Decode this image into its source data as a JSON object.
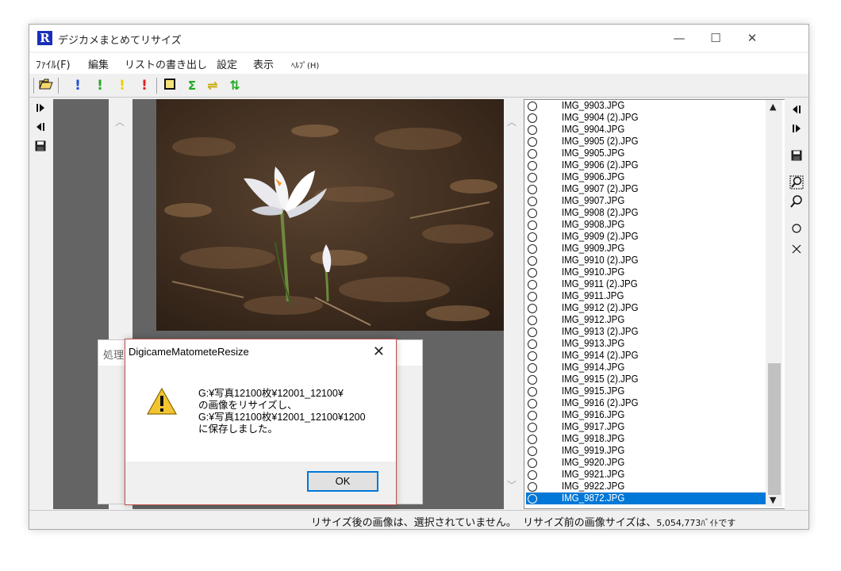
{
  "window": {
    "title": "デジカメまとめてリサイズ",
    "app_icon": "R",
    "minimize": "—",
    "maximize": "☐",
    "close": "✕"
  },
  "menu": [
    {
      "label": "ﾌｧｲﾙ(F)",
      "small": false
    },
    {
      "label": "編集",
      "small": false
    },
    {
      "label": "リストの書き出し",
      "small": false
    },
    {
      "label": "設定",
      "small": false
    },
    {
      "label": "表示",
      "small": false
    },
    {
      "label": "ﾍﾙﾌﾟ(H)",
      "small": true
    }
  ],
  "toolbar": {
    "icons": [
      {
        "name": "open-folder-icon",
        "glyph": "📂",
        "color": "#b8860b"
      },
      {
        "name": "exclaim-blue-icon",
        "glyph": "!",
        "color": "#1e4fd8"
      },
      {
        "name": "exclaim-green-icon",
        "glyph": "!",
        "color": "#22aa22"
      },
      {
        "name": "exclaim-yellow-icon",
        "glyph": "!",
        "color": "#e8d200"
      },
      {
        "name": "exclaim-red-icon",
        "glyph": "!",
        "color": "#e02020"
      },
      {
        "name": "frame-icon",
        "glyph": "□",
        "color": "#111111"
      },
      {
        "name": "sigma-icon",
        "glyph": "Σ",
        "color": "#22aa22"
      },
      {
        "name": "swap-horizontal-icon",
        "glyph": "⇌",
        "color": "#c8a800"
      },
      {
        "name": "swap-vertical-icon",
        "glyph": "⇅",
        "color": "#22aa22"
      }
    ]
  },
  "left_tools": [
    {
      "name": "next-page-icon",
      "glyph": "⧐"
    },
    {
      "name": "prev-page-icon",
      "glyph": "⧏"
    },
    {
      "name": "save-icon",
      "glyph": "💾"
    }
  ],
  "right_tools": [
    {
      "name": "prev-page-icon",
      "glyph": "⧏"
    },
    {
      "name": "next-page-icon",
      "glyph": "⧐"
    },
    {
      "name": "save-icon",
      "glyph": "💾"
    },
    {
      "name": "zoom-fit-icon",
      "glyph": "🔍"
    },
    {
      "name": "zoom-icon",
      "glyph": "🔍"
    },
    {
      "name": "circle-icon",
      "glyph": "○"
    },
    {
      "name": "cross-icon",
      "glyph": "✕"
    }
  ],
  "file_list": [
    "IMG_9903.JPG",
    "IMG_9904 (2).JPG",
    "IMG_9904.JPG",
    "IMG_9905 (2).JPG",
    "IMG_9905.JPG",
    "IMG_9906 (2).JPG",
    "IMG_9906.JPG",
    "IMG_9907 (2).JPG",
    "IMG_9907.JPG",
    "IMG_9908 (2).JPG",
    "IMG_9908.JPG",
    "IMG_9909 (2).JPG",
    "IMG_9909.JPG",
    "IMG_9910 (2).JPG",
    "IMG_9910.JPG",
    "IMG_9911 (2).JPG",
    "IMG_9911.JPG",
    "IMG_9912 (2).JPG",
    "IMG_9912.JPG",
    "IMG_9913 (2).JPG",
    "IMG_9913.JPG",
    "IMG_9914 (2).JPG",
    "IMG_9914.JPG",
    "IMG_9915 (2).JPG",
    "IMG_9915.JPG",
    "IMG_9916 (2).JPG",
    "IMG_9916.JPG",
    "IMG_9917.JPG",
    "IMG_9918.JPG",
    "IMG_9919.JPG",
    "IMG_9920.JPG",
    "IMG_9921.JPG",
    "IMG_9922.JPG",
    "IMG_9872.JPG"
  ],
  "selected_file": "IMG_9872.JPG",
  "status": {
    "text1": "リサイズ後の画像は、選択されていません。",
    "text2": "リサイズ前の画像サイズは、",
    "size": "5,054,773",
    "text3": "ﾊﾞｲﾄです"
  },
  "bg_dialog": {
    "title": "処理"
  },
  "message_box": {
    "title": "DigicameMatometeResize",
    "close": "✕",
    "lines": [
      "G:¥写真12100枚¥12001_12100¥",
      "の画像をリサイズし、",
      "G:¥写真12100枚¥12001_12100¥1200",
      "に保存しました。"
    ],
    "ok_label": "OK",
    "icon": "warning-icon"
  }
}
